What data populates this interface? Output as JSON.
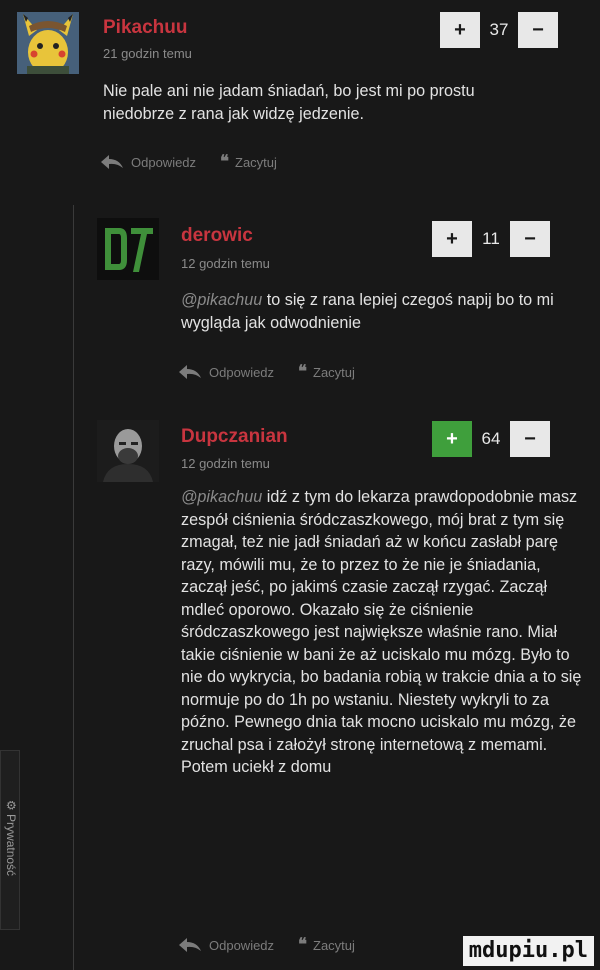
{
  "comments": [
    {
      "username": "Pikachuu",
      "timestamp": "21 godzin temu",
      "mention": "",
      "body": "Nie pale ani nie jadam śniadań, bo jest mi po prostu niedobrze z rana jak widzę jedzenie.",
      "votes": "37",
      "plus_active": false,
      "reply_label": "Odpowiedz",
      "quote_label": "Zacytuj"
    },
    {
      "username": "derowic",
      "timestamp": "12 godzin temu",
      "mention": "@pikachuu",
      "body": " to się z rana lepiej czegoś napij bo to mi wygląda jak odwodnienie",
      "votes": "11",
      "plus_active": false,
      "reply_label": "Odpowiedz",
      "quote_label": "Zacytuj"
    },
    {
      "username": "Dupczanian",
      "timestamp": "12 godzin temu",
      "mention": "@pikachuu",
      "body": " idź z tym do lekarza prawdopodobnie masz zespół ciśnienia śródczaszkowego, mój brat z tym się zmagał, też nie jadł śniadań aż w końcu zasłabł parę razy, mówili mu, że to przez to że nie je śniadania, zaczął jeść, po jakimś czasie zaczął rzygać. Zaczął mdleć oporowo. Okazało się że ciśnienie śródczaszkowego jest największe właśnie rano. Miał takie ciśnienie w bani że aż uciskalo mu mózg. Było to nie do wykrycia, bo badania robią w trakcie dnia a to się normuje po do 1h po wstaniu. Niestety wykryli to za późno. Pewnego dnia tak mocno uciskalo mu mózg, że zruchal psa i założył stronę internetową z memami. Potem uciekł z domu",
      "votes": "64",
      "plus_active": true,
      "reply_label": "Odpowiedz",
      "quote_label": "Zacytuj"
    }
  ],
  "vote_plus": "+",
  "vote_minus": "−",
  "privacy_tab": "Prywatność",
  "watermark": "mdupiu.pl",
  "colors": {
    "username": "#c8353f",
    "plus_active": "#3f9f3c",
    "background": "#181818"
  }
}
